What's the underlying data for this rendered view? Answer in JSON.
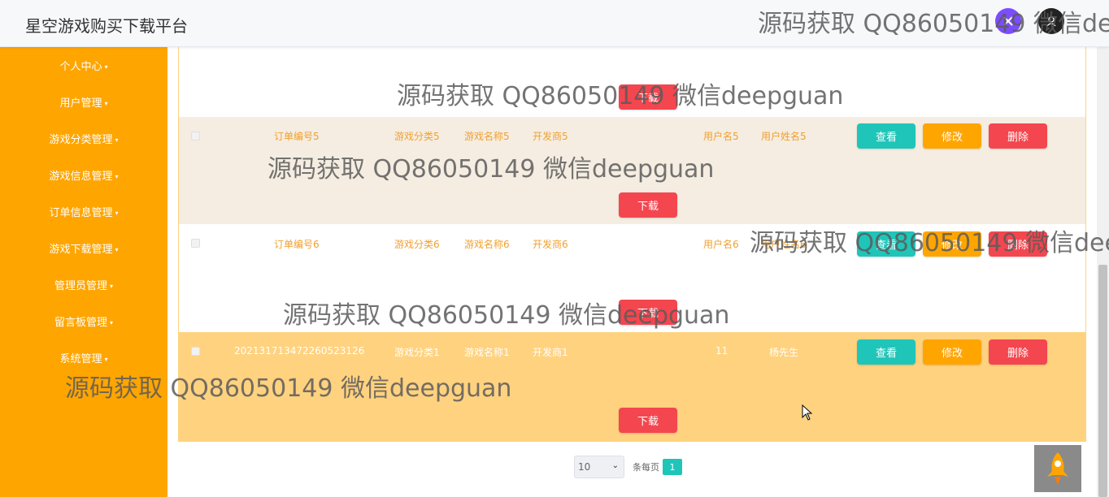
{
  "app": {
    "title": "星空游戏购买下载平台"
  },
  "sidebar": {
    "items": [
      {
        "label": "个人中心"
      },
      {
        "label": "用户管理"
      },
      {
        "label": "游戏分类管理"
      },
      {
        "label": "游戏信息管理"
      },
      {
        "label": "订单信息管理"
      },
      {
        "label": "游戏下载管理"
      },
      {
        "label": "管理员管理"
      },
      {
        "label": "留言板管理"
      },
      {
        "label": "系统管理"
      }
    ]
  },
  "table": {
    "download_label": "下载",
    "view_label": "查看",
    "edit_label": "修改",
    "delete_label": "删除",
    "rows": [
      {
        "order_no": "订单编号5",
        "category": "游戏分类5",
        "game": "游戏名称5",
        "developer": "开发商5",
        "username": "用户名5",
        "realname": "用户姓名5"
      },
      {
        "order_no": "订单编号6",
        "category": "游戏分类6",
        "game": "游戏名称6",
        "developer": "开发商6",
        "username": "用户名6",
        "realname": "用户姓名6"
      },
      {
        "order_no": "202131713472260523126",
        "category": "游戏分类1",
        "game": "游戏名称1",
        "developer": "开发商1",
        "username": "11",
        "realname": "杨先生"
      }
    ]
  },
  "pagination": {
    "page_size": "10",
    "per_page_label": "条每页",
    "current_page": "1"
  },
  "watermark": {
    "text": "源码获取 QQ86050149 微信deepguan"
  },
  "colors": {
    "sidebar": "#ffa500",
    "view": "#20c5b9",
    "edit": "#ffa500",
    "delete": "#f4464f",
    "row_alt": "#f5ede1",
    "row_highlight": "#ffd27f"
  }
}
